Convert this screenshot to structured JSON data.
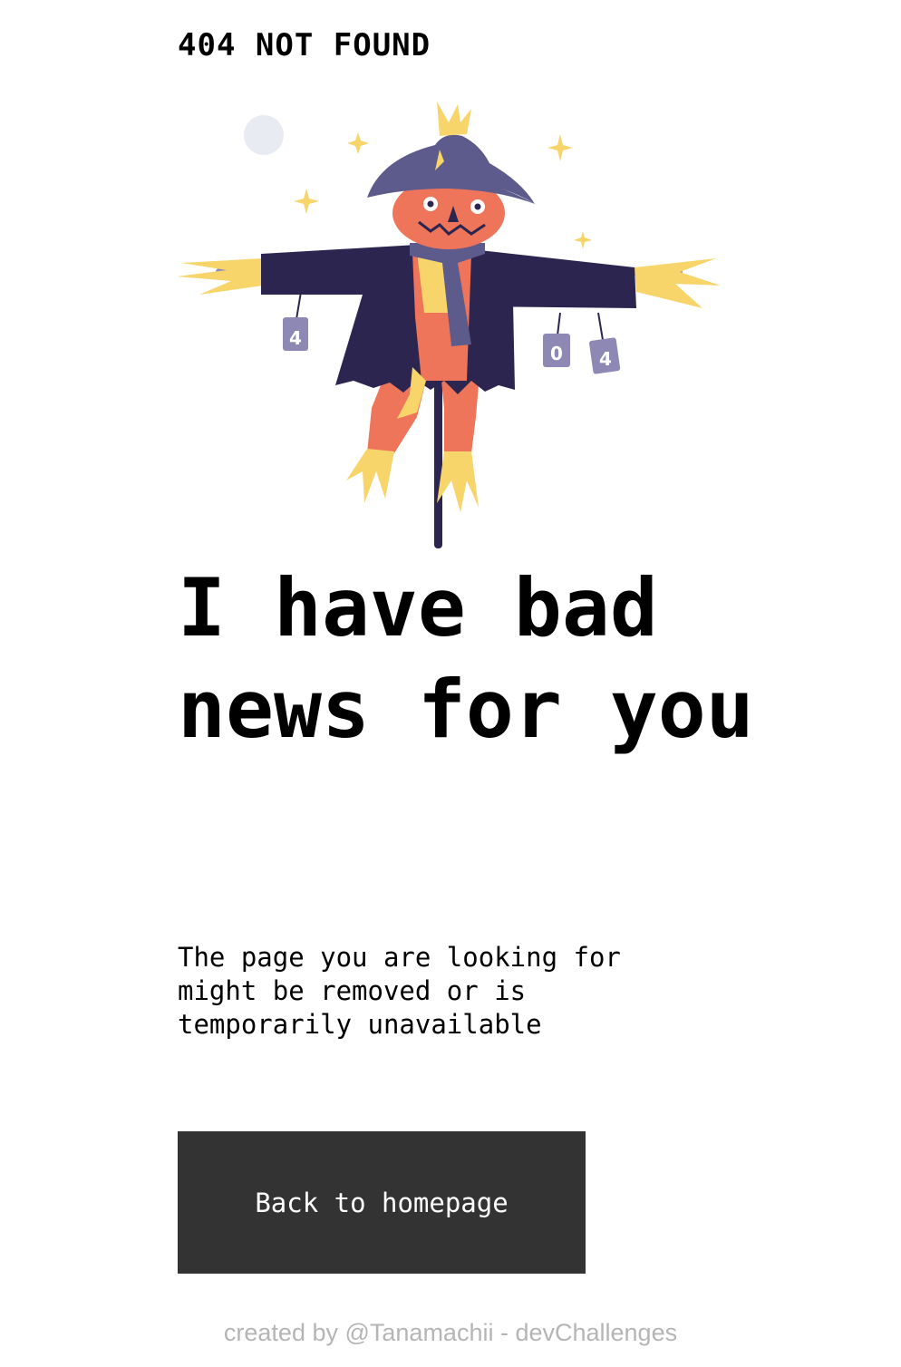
{
  "header": {
    "brand": "404 NOT FOUND"
  },
  "illustration": {
    "can_labels": [
      "4",
      "0",
      "4"
    ]
  },
  "main": {
    "headline": "I have bad news for you",
    "description": "The page you are looking for might be removed or is temporarily unavailable",
    "button_label": "Back to homepage"
  },
  "footer": {
    "credit": "created by @Tanamachii - devChallenges"
  },
  "colors": {
    "button_bg": "#333333",
    "coat": "#2b2550",
    "hat": "#5d5a8c",
    "pumpkin": "#ee7559",
    "straw": "#f7d56b",
    "can": "#8e89b4",
    "moon": "#e9ebf3",
    "footer_text": "#b5b5b5"
  }
}
